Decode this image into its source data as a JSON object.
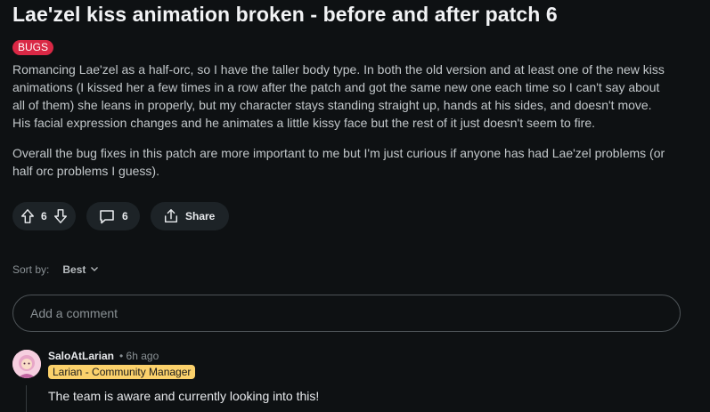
{
  "post": {
    "title": "Lae'zel kiss animation broken - before and after patch 6",
    "flair": "BUGS",
    "paragraphs": [
      "Romancing Lae'zel as a half-orc, so I have the taller body type. In both the old version and at least one of the new kiss animations (I kissed her a few times in a row after the patch and got the same new one each time so I can't say about all of them) she leans in properly, but my character stays standing straight up, hands at his sides, and doesn't move. His facial expression changes and he animates a little kissy face but the rest of it just doesn't seem to fire.",
      "Overall the bug fixes in this patch are more important to me but I'm just curious if anyone has had Lae'zel problems (or half orc problems I guess)."
    ]
  },
  "actions": {
    "vote_count": "6",
    "comment_count": "6",
    "share_label": "Share"
  },
  "sort": {
    "label": "Sort by:",
    "value": "Best"
  },
  "comment_input": {
    "placeholder": "Add a comment"
  },
  "comments": [
    {
      "author": "SaloAtLarian",
      "time": "• 6h ago",
      "flair": "Larian - Community Manager",
      "text": "The team is aware and currently looking into this!"
    }
  ],
  "colors": {
    "background": "#0e1113",
    "post_flair": "#d92845",
    "user_flair": "#fbd16b",
    "pill": "#1d2327"
  },
  "icons": [
    "upvote-icon",
    "downvote-icon",
    "comment-icon",
    "share-icon",
    "chevron-down-icon"
  ]
}
